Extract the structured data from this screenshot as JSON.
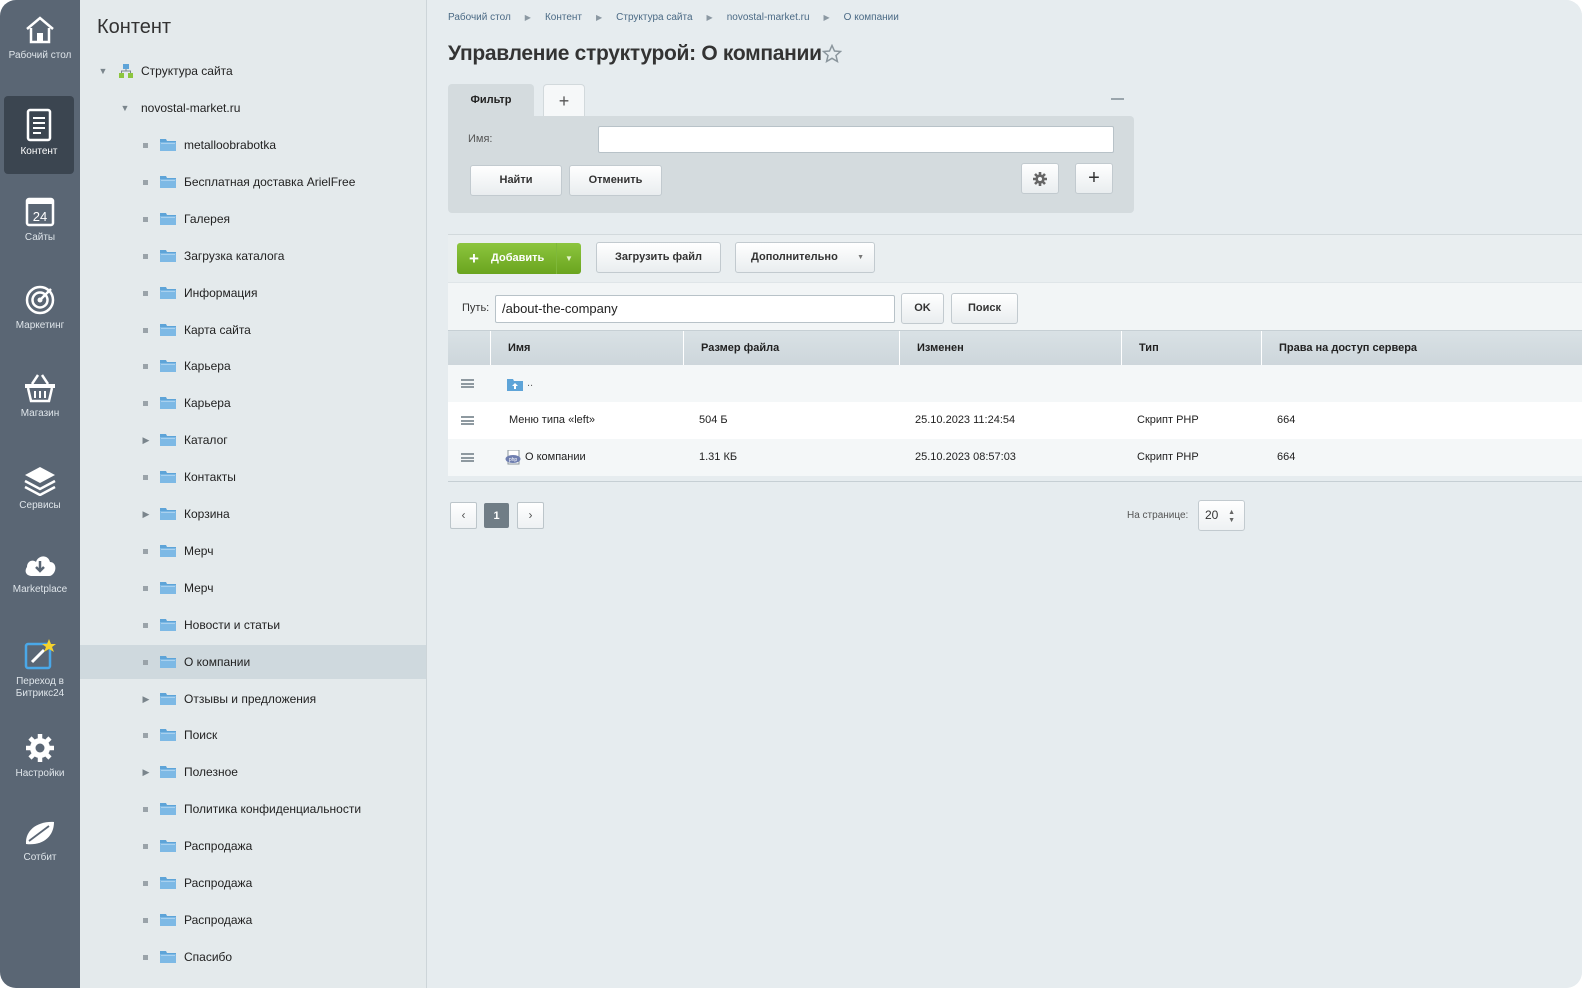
{
  "sidebar": {
    "items": [
      {
        "label": "Рабочий стол",
        "icon": "home-icon"
      },
      {
        "label": "Контент",
        "icon": "document-icon"
      },
      {
        "label": "Сайты",
        "icon": "calendar-24-icon"
      },
      {
        "label": "Маркетинг",
        "icon": "target-icon"
      },
      {
        "label": "Магазин",
        "icon": "basket-icon"
      },
      {
        "label": "Сервисы",
        "icon": "layers-icon"
      },
      {
        "label": "Marketplace",
        "icon": "cloud-download-icon"
      },
      {
        "label": "Переход в",
        "label2": "Битрикс24",
        "icon": "bitrix24-transition-icon"
      },
      {
        "label": "Настройки",
        "icon": "gear-icon"
      },
      {
        "label": "Сотбит",
        "icon": "sotbit-leaf-icon"
      }
    ]
  },
  "tree": {
    "title": "Контент",
    "root": "Структура сайта",
    "site": "novostal-market.ru",
    "items": [
      {
        "label": "metalloobrabotka",
        "expandable": false
      },
      {
        "label": "Бесплатная доставка ArielFree",
        "expandable": false
      },
      {
        "label": "Галерея",
        "expandable": false
      },
      {
        "label": "Загрузка каталога",
        "expandable": false
      },
      {
        "label": "Информация",
        "expandable": false
      },
      {
        "label": "Карта сайта",
        "expandable": false
      },
      {
        "label": "Карьера",
        "expandable": false
      },
      {
        "label": "Карьера",
        "expandable": false
      },
      {
        "label": "Каталог",
        "expandable": true
      },
      {
        "label": "Контакты",
        "expandable": false
      },
      {
        "label": "Корзина",
        "expandable": true
      },
      {
        "label": "Мерч",
        "expandable": false
      },
      {
        "label": "Мерч",
        "expandable": false
      },
      {
        "label": "Новости и статьи",
        "expandable": false
      },
      {
        "label": "О компании",
        "expandable": false,
        "selected": true
      },
      {
        "label": "Отзывы и предложения",
        "expandable": true
      },
      {
        "label": "Поиск",
        "expandable": false
      },
      {
        "label": "Полезное",
        "expandable": true
      },
      {
        "label": "Политика конфиденциальности",
        "expandable": false
      },
      {
        "label": "Распродажа",
        "expandable": false
      },
      {
        "label": "Распродажа",
        "expandable": false
      },
      {
        "label": "Распродажа",
        "expandable": false
      },
      {
        "label": "Спасибо",
        "expandable": false
      }
    ]
  },
  "breadcrumb": [
    "Рабочий стол",
    "Контент",
    "Структура сайта",
    "novostal-market.ru",
    "О компании"
  ],
  "page": {
    "title": "Управление структурой: О компании"
  },
  "filter": {
    "tab_label": "Фильтр",
    "add_tab": "+",
    "name_label": "Имя:",
    "name_value": "",
    "find_label": "Найти",
    "cancel_label": "Отменить",
    "add_label": "+"
  },
  "toolbar": {
    "add_label": "Добавить",
    "upload_label": "Загрузить файл",
    "more_label": "Дополнительно"
  },
  "path": {
    "label": "Путь:",
    "value": "/about-the-company",
    "ok_label": "OK",
    "search_label": "Поиск"
  },
  "table": {
    "columns": [
      "Имя",
      "Размер файла",
      "Изменен",
      "Тип",
      "Права на доступ сервера"
    ],
    "up_row": "..",
    "rows": [
      {
        "name": "Меню типа «left»",
        "size": "504 Б",
        "modified": "25.10.2023 11:24:54",
        "type": "Скрипт PHP",
        "rights": "664"
      },
      {
        "name": "О компании",
        "size": "1.31 КБ",
        "modified": "25.10.2023 08:57:03",
        "type": "Скрипт PHP",
        "rights": "664"
      }
    ]
  },
  "pagination": {
    "prev": "‹",
    "current": "1",
    "next": "›",
    "per_page_label": "На странице:",
    "per_page_value": "20"
  },
  "colors": {
    "sidebar_bg": "#5a6674",
    "accent_green": "#7cb52c",
    "folder_blue": "#5ea4d8"
  }
}
